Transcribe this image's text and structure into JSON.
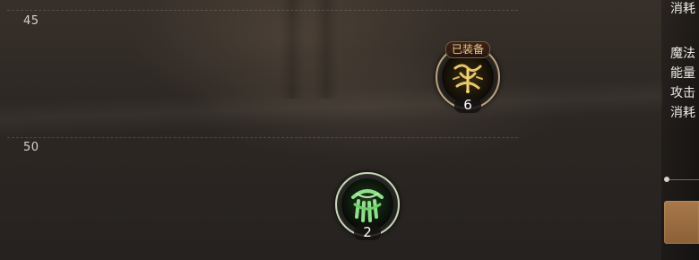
{
  "skill_tree": {
    "levels": [
      {
        "label": "45"
      },
      {
        "label": "50"
      }
    ],
    "skills": [
      {
        "name": "gold-rune-skill",
        "badge": "已装备",
        "level": "6",
        "icon": "golden-rune-icon",
        "ring_color": "#bba27a",
        "glow_color": "#e7c56a"
      },
      {
        "name": "green-claw-skill",
        "badge": "",
        "level": "2",
        "icon": "green-claw-icon",
        "ring_color": "#c7d6b9",
        "glow_color": "#8fe08a"
      }
    ]
  },
  "info_panel": {
    "lines": [
      "消耗",
      "魔法",
      "能量",
      "攻击",
      "消耗"
    ]
  }
}
